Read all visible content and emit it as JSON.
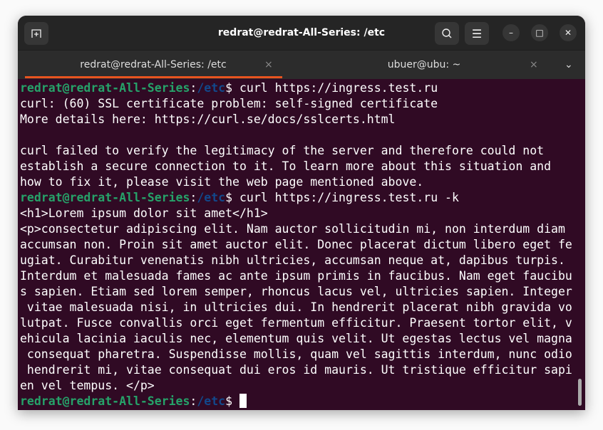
{
  "window": {
    "title": "redrat@redrat-All-Series: /etc"
  },
  "tabs": [
    {
      "label": "redrat@redrat-All-Series: /etc",
      "active": true
    },
    {
      "label": "ubuer@ubu: ~",
      "active": false
    }
  ],
  "icons": {
    "new_tab": "+",
    "search": "search-icon",
    "menu": "☰",
    "minimize": "–",
    "maximize": "□",
    "close": "✕",
    "tab_close": "×",
    "tabs_dropdown": "⌄"
  },
  "colors": {
    "background": "#300a24",
    "user": "#26a269",
    "path": "#12488b",
    "accent": "#e95420"
  },
  "prompt": {
    "user": "redrat@redrat-All-Series",
    "sep": ":",
    "path": "/etc",
    "dollar": "$"
  },
  "terminal": {
    "cmd1": " curl https://ingress.test.ru",
    "cmd2": " curl https://ingress.test.ru -k",
    "cmd3": " ",
    "lines": [
      "curl: (60) SSL certificate problem: self-signed certificate",
      "More details here: https://curl.se/docs/sslcerts.html",
      "",
      "curl failed to verify the legitimacy of the server and therefore could not",
      "establish a secure connection to it. To learn more about this situation and",
      "how to fix it, please visit the web page mentioned above.",
      "<h1>Lorem ipsum dolor sit amet</h1>",
      "<p>consectetur adipiscing elit. Nam auctor sollicitudin mi, non interdum diam",
      "accumsan non. Proin sit amet auctor elit. Donec placerat dictum libero eget fe",
      "ugiat. Curabitur venenatis nibh ultricies, accumsan neque at, dapibus turpis.",
      "Interdum et malesuada fames ac ante ipsum primis in faucibus. Nam eget faucibu",
      "s sapien. Etiam sed lorem semper, rhoncus lacus vel, ultricies sapien. Integer",
      " vitae malesuada nisi, in ultricies dui. In hendrerit placerat nibh gravida vo",
      "lutpat. Fusce convallis orci eget fermentum efficitur. Praesent tortor elit, v",
      "ehicula lacinia iaculis nec, elementum quis velit. Ut egestas lectus vel magna",
      " consequat pharetra. Suspendisse mollis, quam vel sagittis interdum, nunc odio",
      " hendrerit mi, vitae consequat dui eros id mauris. Ut tristique efficitur sapi",
      "en vel tempus. </p>"
    ]
  }
}
